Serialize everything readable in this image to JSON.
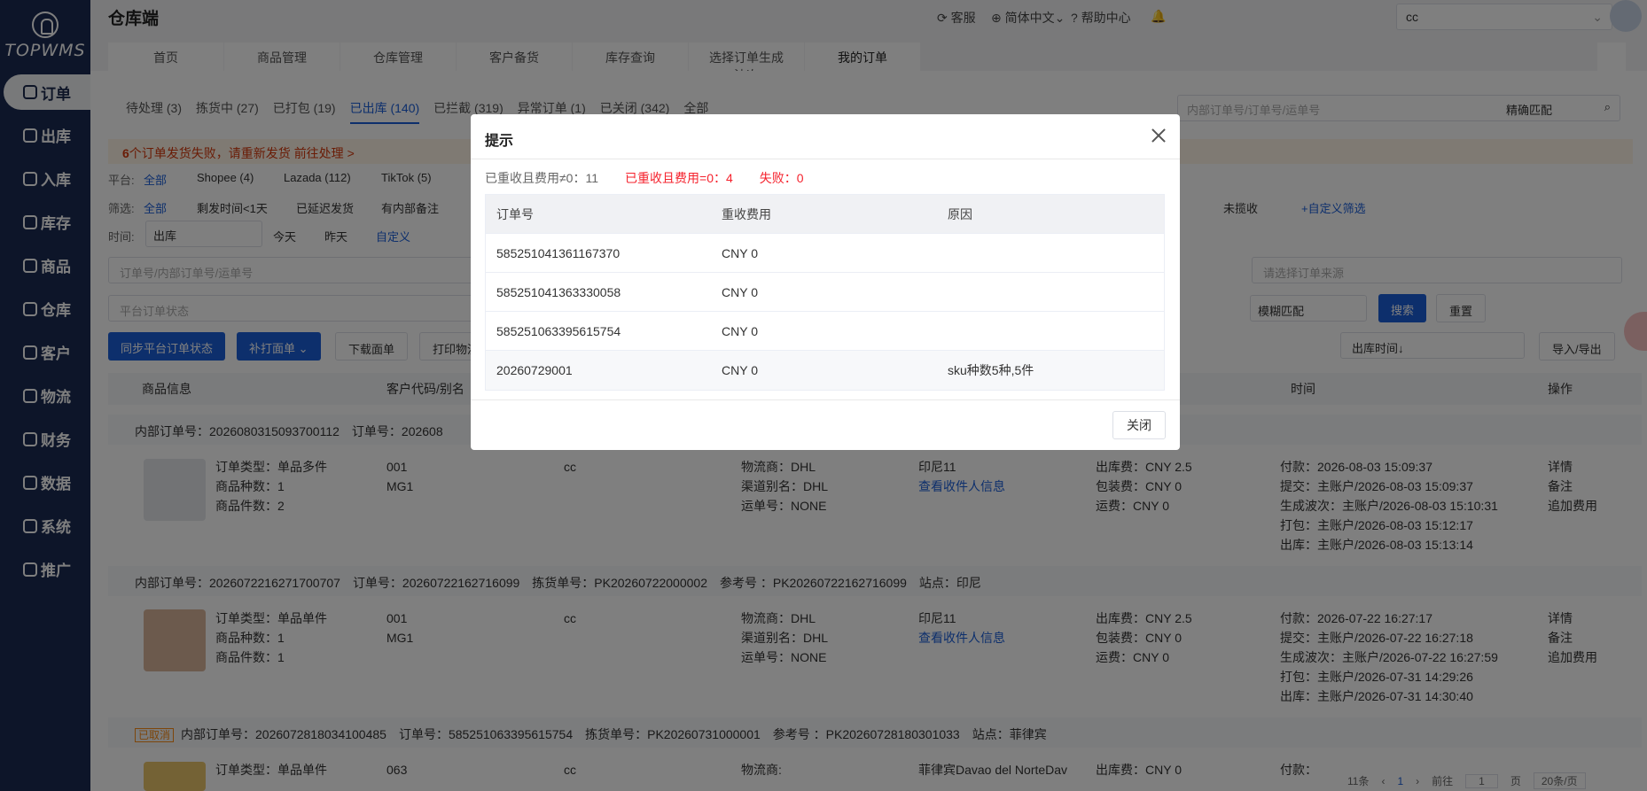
{
  "brand": {
    "logo_text": "TOPWMS"
  },
  "sidebar": {
    "items": [
      {
        "label": "订单",
        "icon": "order-icon",
        "active": true
      },
      {
        "label": "出库",
        "icon": "outbound-icon"
      },
      {
        "label": "入库",
        "icon": "inbound-icon"
      },
      {
        "label": "库存",
        "icon": "inventory-icon"
      },
      {
        "label": "商品",
        "icon": "product-icon"
      },
      {
        "label": "仓库",
        "icon": "warehouse-icon"
      },
      {
        "label": "客户",
        "icon": "customer-icon"
      },
      {
        "label": "物流",
        "icon": "logistics-icon"
      },
      {
        "label": "财务",
        "icon": "finance-icon"
      },
      {
        "label": "数据",
        "icon": "data-icon"
      },
      {
        "label": "系统",
        "icon": "system-icon"
      },
      {
        "label": "推广",
        "icon": "promo-icon"
      }
    ]
  },
  "header": {
    "title": "仓库端",
    "service": "客服",
    "language": "简体中文",
    "help": "帮助中心",
    "account_select": "cc"
  },
  "tabs": [
    "首页",
    "商品管理",
    "仓库管理",
    "客户备货",
    "库存查询",
    "选择订单生成波次",
    "我的订单"
  ],
  "subtabs": [
    "待处理 (3)",
    "拣货中 (27)",
    "已打包 (19)",
    "已出库 (140)",
    "已拦截 (319)",
    "异常订单 (1)",
    "已关闭 (342)",
    "全部"
  ],
  "top_search": {
    "placeholder": "内部订单号/订单号/运单号",
    "match": "精确匹配"
  },
  "warning": {
    "count": "6",
    "text": "个订单发货失败，请重新发货",
    "action": "前往处理 >"
  },
  "filters": {
    "platform_label": "平台:",
    "platform_all": "全部",
    "platforms": [
      "Shopee (4)",
      "Lazada (112)",
      "TikTok (5)"
    ],
    "screen_label": "筛选:",
    "screen_all": "全部",
    "screens": [
      "剩发时间<1天",
      "已延迟发货",
      "有内部备注"
    ],
    "time_label": "时间:",
    "time_type": "出库",
    "time_opts": [
      "今天",
      "昨天",
      "自定义"
    ],
    "order_search_placeholder": "订单号/内部订单号/运单号",
    "platform_status_placeholder": "平台订单状态",
    "source_placeholder": "请选择订单来源",
    "fuzzy": "模糊匹配",
    "search": "搜索",
    "reset": "重置",
    "unpicked": "未揽收",
    "custom_filter": "+自定义筛选",
    "sort": "出库时间↓",
    "import_export": "导入/导出"
  },
  "actions": {
    "sync": "同步平台订单状态",
    "reprint": "补打面单",
    "download": "下载面单",
    "print": "打印物流"
  },
  "table": {
    "headers": [
      "商品信息",
      "客户代码/别名",
      "时间",
      "操作"
    ]
  },
  "orders": [
    {
      "group": "内部订单号：2026080315093700112",
      "group_tail": "订单号：202608",
      "type": "订单类型：单品多件",
      "kinds": "商品种数：1",
      "count": "商品件数：2",
      "code": "001",
      "alias": "MG1",
      "customer": "cc",
      "carrier": "物流商：DHL",
      "channel": "渠道别名：DHL",
      "waybill": "运单号：NONE",
      "dest": "印尼11",
      "view": "查看收件人信息",
      "fee1": "出库费：CNY 2.5",
      "fee2": "包装费：CNY 0",
      "fee3": "运费：CNY 0",
      "t1": "付款：2026-08-03 15:09:37",
      "t2": "提交：主账户/2026-08-03 15:09:37",
      "t3": "生成波次：主账户/2026-08-03 15:10:31",
      "t4": "打包：主账户/2026-08-03 15:12:17",
      "t5": "出库：主账户/2026-08-03 15:13:14",
      "op1": "详情",
      "op2": "备注",
      "op3": "追加费用"
    },
    {
      "group": "内部订单号：2026072216271700707",
      "group_tail": "订单号：20260722162716099　拣货单号：PK20260722000002　参考号 ：PK20260722162716099　站点：印尼",
      "type": "订单类型：单品单件",
      "kinds": "商品种数：1",
      "count": "商品件数：1",
      "code": "001",
      "alias": "MG1",
      "customer": "cc",
      "carrier": "物流商：DHL",
      "channel": "渠道别名：DHL",
      "waybill": "运单号：NONE",
      "dest": "印尼11",
      "view": "查看收件人信息",
      "fee1": "出库费：CNY 2.5",
      "fee2": "包装费：CNY 0",
      "fee3": "运费：CNY 0",
      "t1": "付款：2026-07-22 16:27:17",
      "t2": "提交：主账户/2026-07-22 16:27:18",
      "t3": "生成波次：主账户/2026-07-22 16:27:59",
      "t4": "打包：主账户/2026-07-31 14:29:26",
      "t5": "出库：主账户/2026-07-31 14:30:40",
      "op1": "详情",
      "op2": "备注",
      "op3": "追加费用"
    }
  ],
  "order3": {
    "badge": "已取消",
    "group": "内部订单号：2026072818034100485　订单号：585251063395615754　拣货单号：PK20260731000001　参考号 ：PK20260728180301033　站点：菲律宾",
    "type": "订单类型：单品单件",
    "code": "063",
    "customer": "cc",
    "carrier": "物流商:",
    "dest": "菲律宾Davao del NorteDav",
    "fee1": "出库费：CNY 0",
    "pay": "付款：",
    "pager_total": "11条",
    "pager_page": "1",
    "pager_goto": "前往",
    "pager_input": "1",
    "pager_unit": "页",
    "pager_size": "20条/页"
  },
  "dialog": {
    "title": "提示",
    "summary_a": "已重收且费用≠0：11",
    "summary_b": "已重收且费用=0：4",
    "summary_c": "失败：0",
    "col_order": "订单号",
    "col_fee": "重收费用",
    "col_reason": "原因",
    "rows": [
      {
        "order": "585251041361167370",
        "fee": "CNY 0",
        "reason": ""
      },
      {
        "order": "585251041363330058",
        "fee": "CNY 0",
        "reason": ""
      },
      {
        "order": "585251063395615754",
        "fee": "CNY 0",
        "reason": ""
      },
      {
        "order": "20260729001",
        "fee": "CNY 0",
        "reason": "sku种数5种,5件"
      }
    ],
    "close": "关闭"
  },
  "colors": {
    "sidebar": "#1a2a52",
    "primary": "#1a5ed9",
    "danger": "#f5222d"
  }
}
